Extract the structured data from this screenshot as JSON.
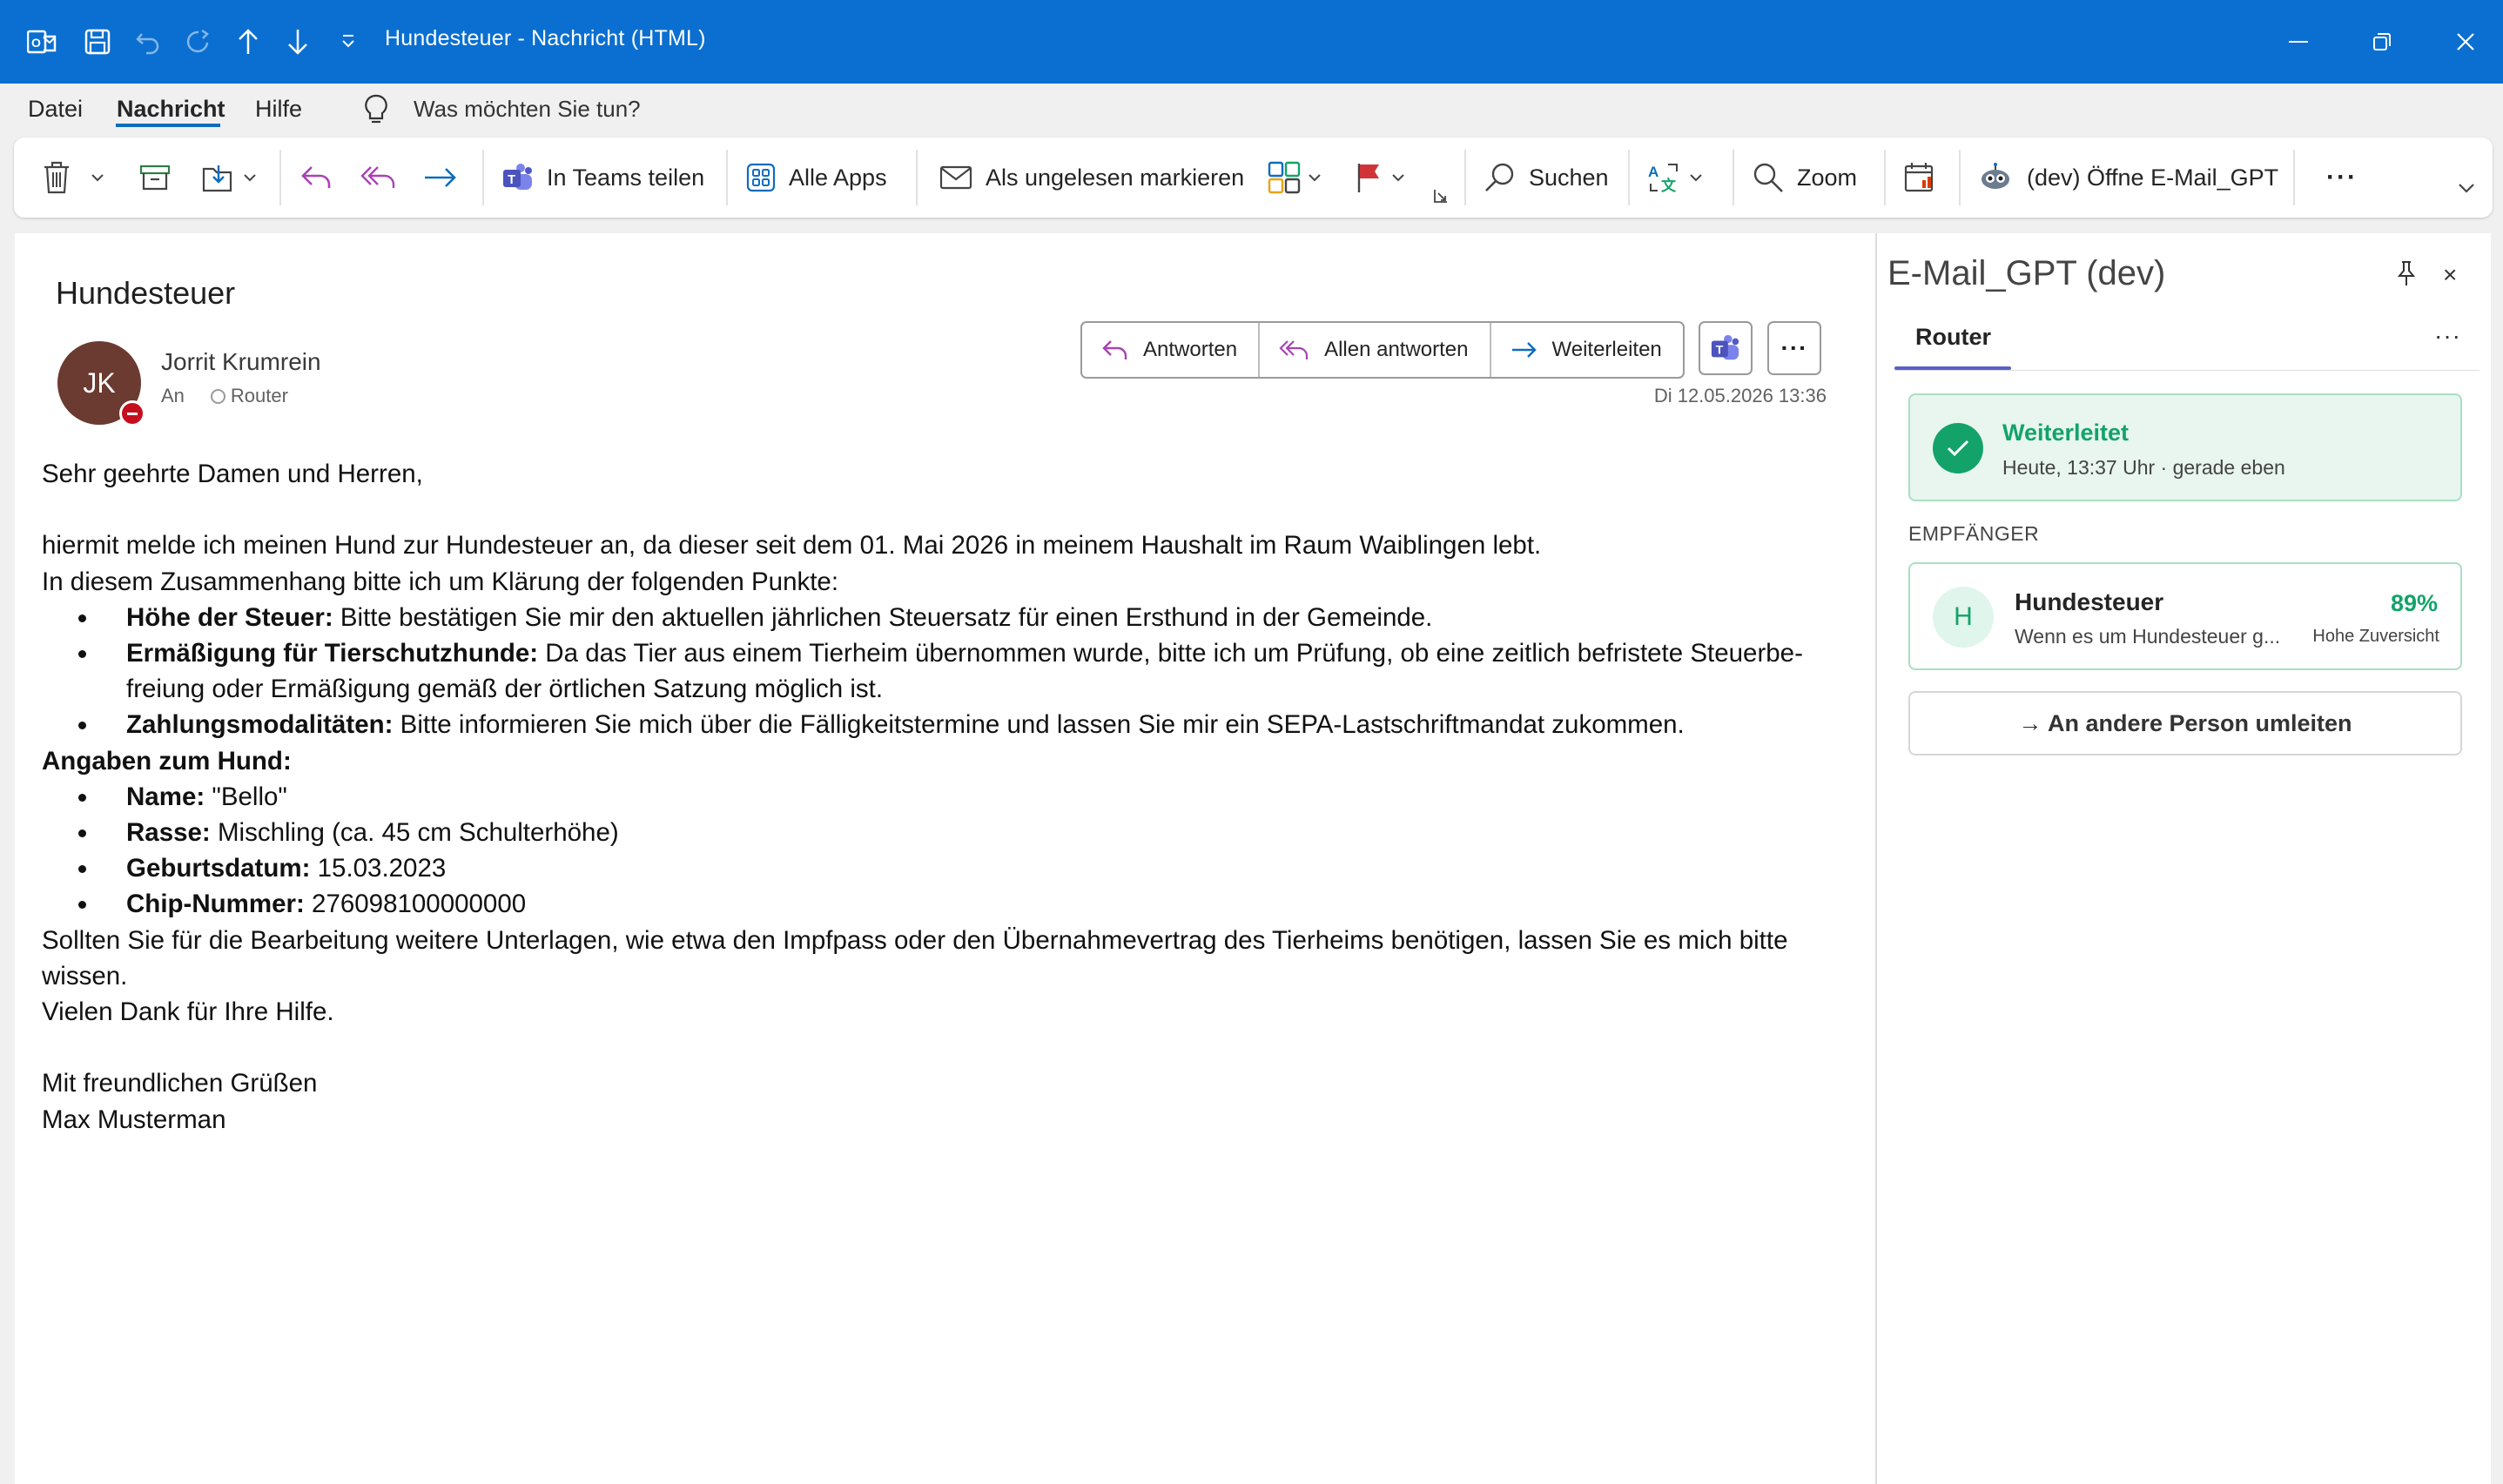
{
  "window": {
    "title": "Hundesteuer  -  Nachricht (HTML)"
  },
  "menu": {
    "items": [
      "Datei",
      "Nachricht",
      "Hilfe"
    ],
    "tell_me": "Was möchten Sie tun?"
  },
  "ribbon": {
    "teams_share": "In Teams teilen",
    "all_apps": "Alle Apps",
    "mark_unread": "Als ungelesen markieren",
    "search": "Suchen",
    "zoom": "Zoom",
    "email_gpt": "(dev) Öffne E-Mail_GPT",
    "more": "···"
  },
  "message": {
    "subject": "Hundesteuer",
    "sender_initials": "JK",
    "sender_name": "Jorrit Krumrein",
    "to_label": "An",
    "to_recipient": "Router",
    "date": "Di 12.05.2026 13:36",
    "actions": {
      "reply": "Antworten",
      "reply_all": "Allen antworten",
      "forward": "Weiterleiten",
      "more": "···"
    },
    "body": {
      "greeting": "Sehr geehrte Damen und Herren,",
      "intro": "hiermit melde ich meinen Hund zur Hundesteuer an, da dieser seit dem 01. Mai 2026 in meinem Haushalt im Raum Waiblingen lebt.",
      "request_intro": "In diesem Zusammenhang bitte ich um Klärung der folgenden Punkte:",
      "points": [
        {
          "label": "Höhe der Steuer:",
          "text": " Bitte bestätigen Sie mir den aktuellen jährlichen Steuersatz für einen Ersthund in der Gemeinde."
        },
        {
          "label": "Ermäßigung für Tierschutzhunde:",
          "text": " Da das Tier aus einem Tierheim übernommen wurde, bitte ich um Prüfung, ob eine zeitlich befristete Steuerbe-freiung oder Ermäßigung gemäß der örtlichen Satzung möglich ist."
        },
        {
          "label": "Zahlungsmodalitäten:",
          "text": " Bitte informieren Sie mich über die Fälligkeitstermine und lassen Sie mir ein SEPA-Lastschriftmandat zukommen."
        }
      ],
      "dog_heading": "Angaben zum Hund:",
      "dog": [
        {
          "label": "Name:",
          "text": " \"Bello\""
        },
        {
          "label": "Rasse:",
          "text": " Mischling (ca. 45 cm Schulterhöhe)"
        },
        {
          "label": "Geburtsdatum:",
          "text": " 15.03.2023"
        },
        {
          "label": "Chip-Nummer:",
          "text": " 276098100000000"
        }
      ],
      "docs": "Sollten Sie für die Bearbeitung weitere Unterlagen, wie etwa den Impfpass oder den Übernahmevertrag des Tierheims benötigen, lassen Sie es mich bitte wissen.",
      "thanks": "Vielen Dank für Ihre Hilfe.",
      "closing": "Mit freundlichen Grüßen",
      "signature": "Max Musterman"
    }
  },
  "panel": {
    "title": "E-Mail_GPT (dev)",
    "close": "×",
    "tab": "Router",
    "more": "···",
    "status": {
      "title": "Weiterleitet",
      "subtitle": "Heute, 13:37 Uhr · gerade eben"
    },
    "section_label": "EMPFÄNGER",
    "recipient": {
      "initial": "H",
      "name": "Hundesteuer",
      "description": "Wenn es um Hundesteuer g...",
      "confidence_pct": "89%",
      "confidence_label": "Hohe Zuversicht"
    },
    "redirect_label": "→ An andere Person umleiten"
  },
  "colors": {
    "titlebar": "#0a6fd0",
    "success": "#13a36a",
    "tab_accent": "#5b5fc7",
    "avatar": "#6b3a30",
    "presence_busy": "#c50f1f"
  }
}
